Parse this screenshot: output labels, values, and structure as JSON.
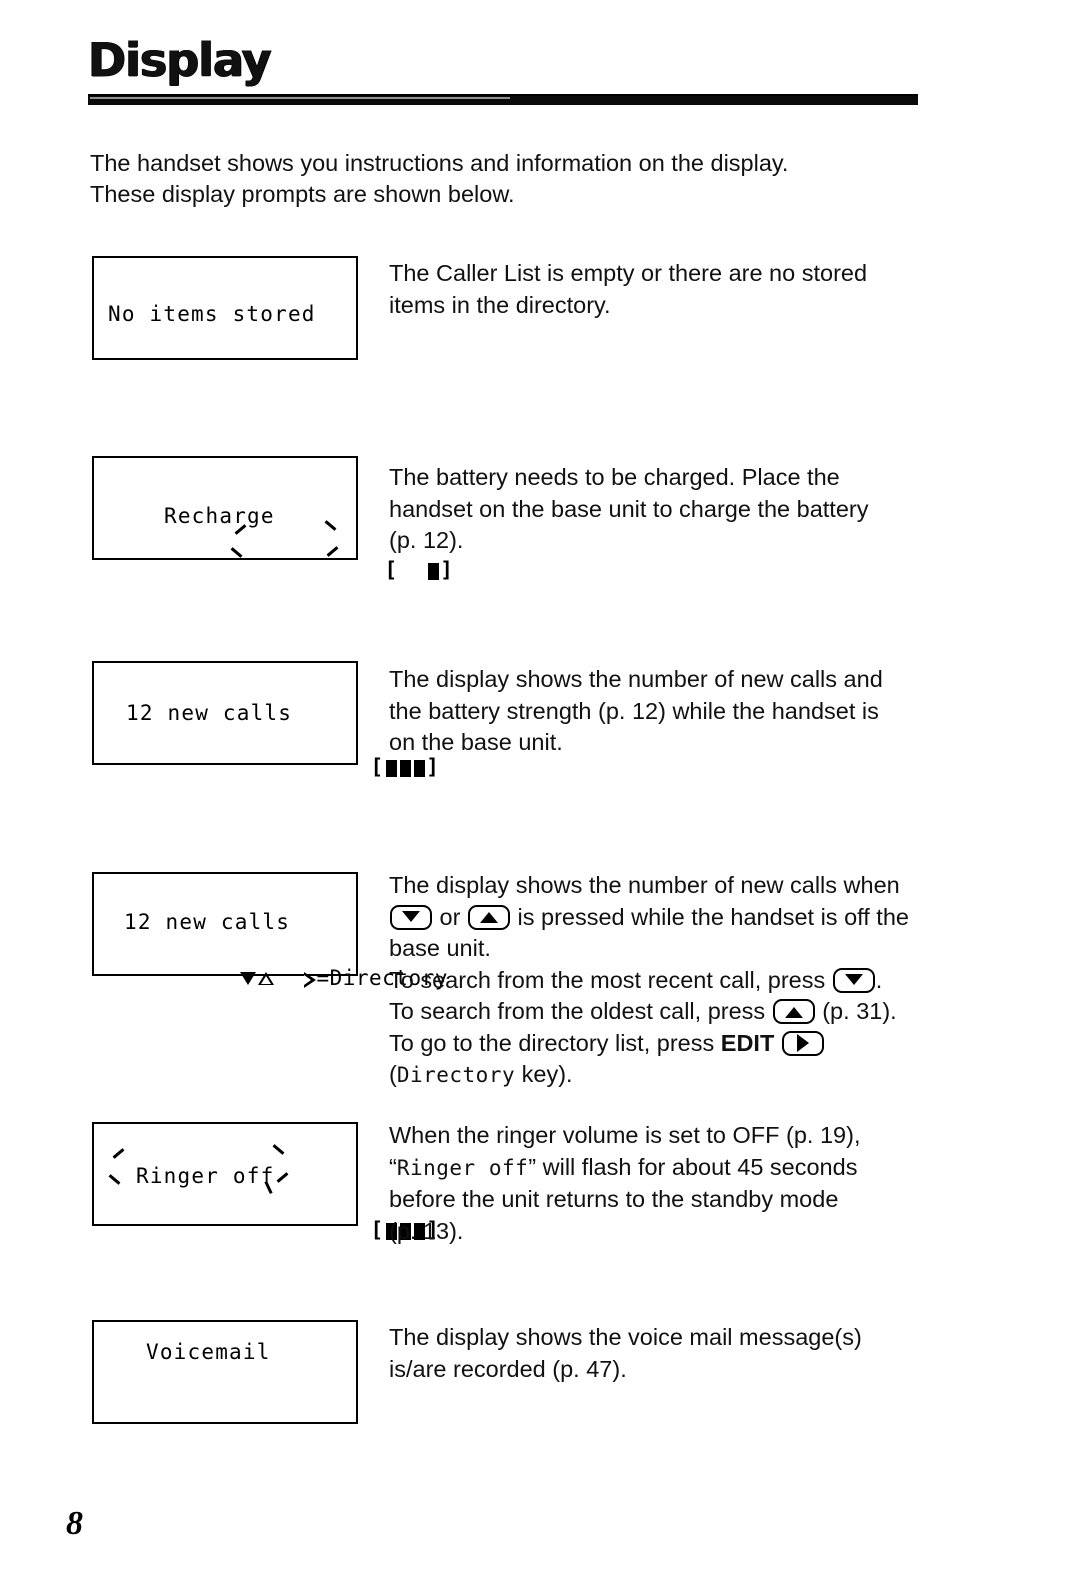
{
  "document": {
    "title": "Display",
    "page_number": "8",
    "intro_lines": [
      "The handset shows you instructions and information on the display.",
      "These display prompts are shown below."
    ]
  },
  "entries": [
    {
      "id": "no-items-stored",
      "lcd": {
        "line1": "No items stored",
        "line2": "",
        "battery": "",
        "flashing": false
      },
      "description_lines": [
        "The Caller List is empty or there are no stored",
        "items in the directory."
      ]
    },
    {
      "id": "recharge",
      "lcd": {
        "line1": "Recharge",
        "line2": "",
        "battery": "[  ▯]",
        "battery_segments": [
          "gap",
          "gap",
          "full"
        ],
        "flashing": true
      },
      "description_lines": [
        "The battery needs to be charged. Place the",
        "handset on the base unit to charge the battery",
        "(p. 12)."
      ]
    },
    {
      "id": "new-calls-on-base",
      "lcd": {
        "line1": "12 new calls",
        "line2": "",
        "battery": "[▯▯▯]",
        "battery_segments": [
          "full",
          "full",
          "full"
        ],
        "flashing": false
      },
      "description_lines": [
        "The display shows the number of new calls and",
        "the battery strength (p. 12) while the handset is",
        "on the base unit."
      ]
    },
    {
      "id": "new-calls-off-base",
      "lcd": {
        "line1": "12 new calls",
        "line2_prefix": "",
        "line2_text": "=Directory",
        "indicators": [
          "down-arrow-filled",
          "up-arrow-outline",
          "right-arrow-outline"
        ],
        "flashing": false
      },
      "description_lines": [
        "The display shows the number of new calls when",
        "base unit.",
        "(Directory key)."
      ],
      "rich_lines": {
        "l1": "The display shows the number of new calls when",
        "l2_a": "or",
        "l2_b": "is pressed while the handset is off the",
        "l3": "base unit.",
        "l4_a": "To search from the most recent call, press",
        "l4_b": ".",
        "l5_a": "To search from the oldest call, press",
        "l5_b": "(p. 31).",
        "l6_a": "To go to the directory list, press",
        "l6_b": "EDIT",
        "l7_a": "(",
        "l7_mono": "Directory",
        "l7_b": " key)."
      }
    },
    {
      "id": "ringer-off",
      "lcd": {
        "line1": "Ringer off",
        "line2": "",
        "battery": "[▯▯▯]",
        "battery_segments": [
          "full",
          "full",
          "full"
        ],
        "flashing": true
      },
      "rich_lines": {
        "l1": "When the ringer volume is set to OFF (p. 19),",
        "l2_open": "“",
        "l2_mono": "Ringer off",
        "l2_close": "”",
        "l2_rest": " will flash for about 45 seconds",
        "l3": "before the unit returns to the standby mode",
        "l4": "(p. 13)."
      }
    },
    {
      "id": "voicemail",
      "lcd": {
        "line1": "Voicemail",
        "line2": "",
        "battery": "",
        "flashing": false
      },
      "description_lines": [
        "The display shows the voice mail message(s)",
        "is/are recorded (p. 47)."
      ]
    }
  ]
}
